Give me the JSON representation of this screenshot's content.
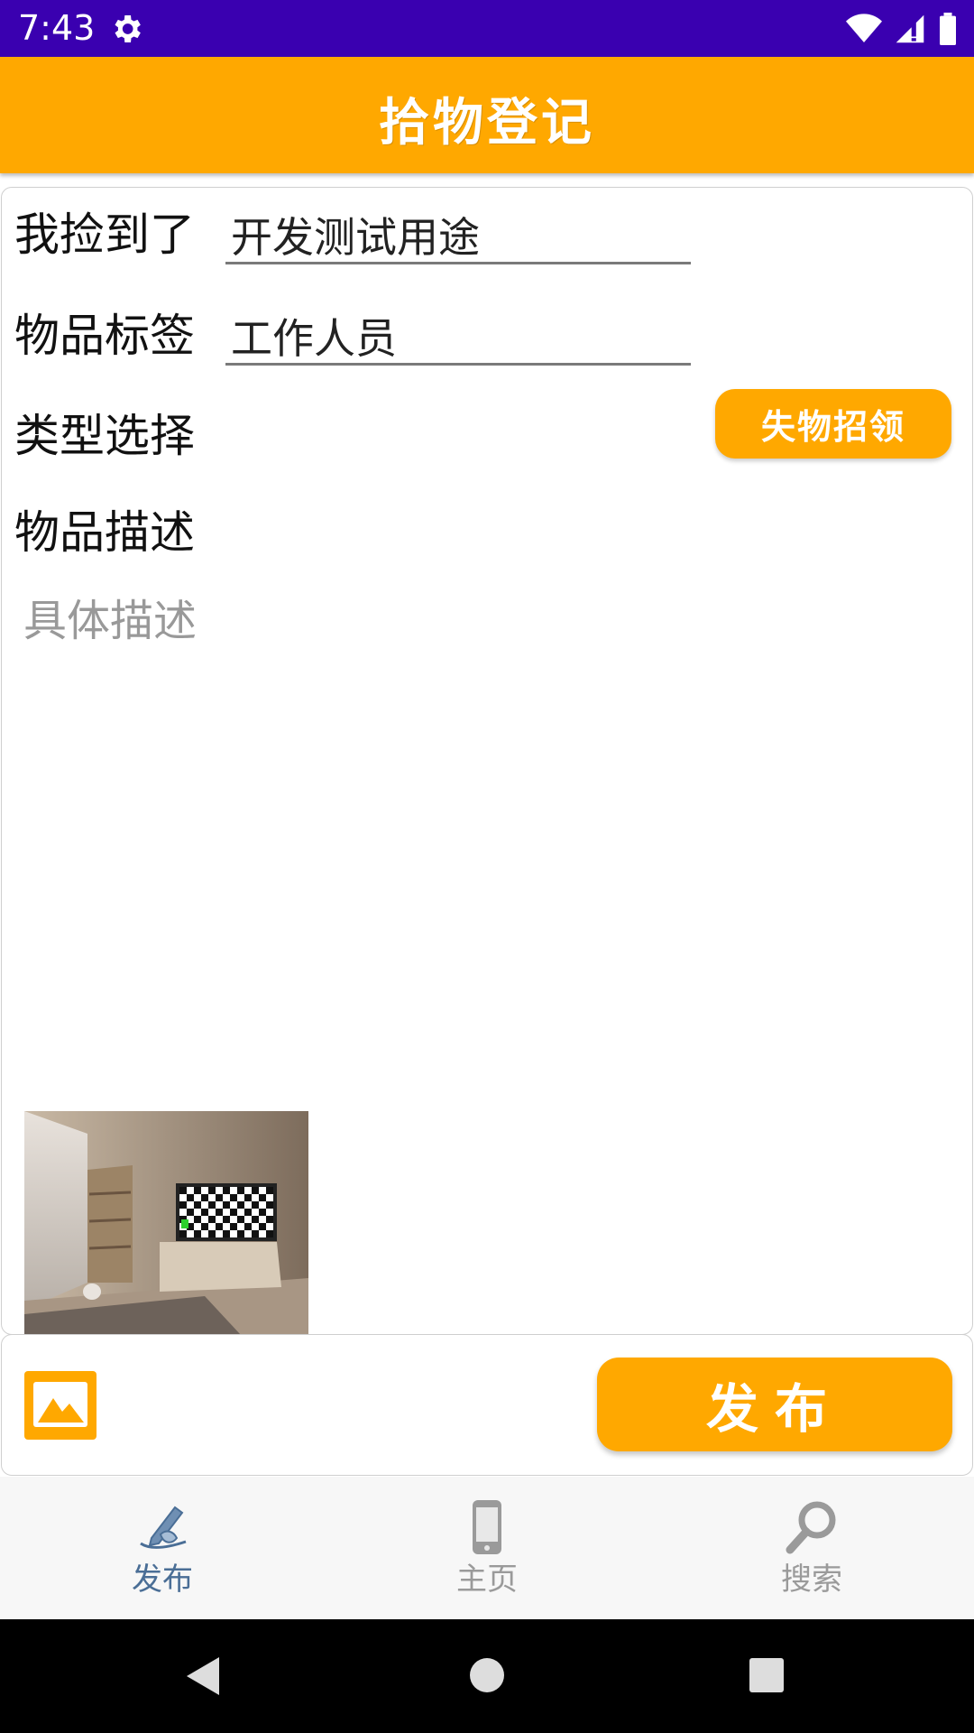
{
  "status_bar": {
    "time": "7:43"
  },
  "app_bar": {
    "title": "拾物登记"
  },
  "form": {
    "found_label": "我捡到了",
    "found_value": "开发测试用途",
    "tag_label": "物品标签",
    "tag_value": "工作人员",
    "type_label": "类型选择",
    "type_button": "失物招领",
    "desc_label": "物品描述",
    "desc_placeholder": "具体描述"
  },
  "actions": {
    "publish_label": "发布"
  },
  "bottom_nav": {
    "items": [
      {
        "label": "发布",
        "icon": "pen-write-icon",
        "active": true
      },
      {
        "label": "主页",
        "icon": "phone-icon",
        "active": false
      },
      {
        "label": "搜索",
        "icon": "magnifier-icon",
        "active": false
      }
    ]
  },
  "colors": {
    "status_bar": "#3a00b0",
    "accent": "#ffa800",
    "nav_active": "#4a6e96",
    "nav_inactive": "#9a9a9a"
  }
}
